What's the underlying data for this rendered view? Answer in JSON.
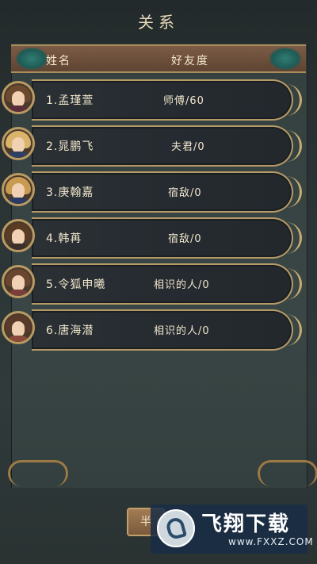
{
  "screen": {
    "title": "关系"
  },
  "table": {
    "headers": {
      "name": "姓名",
      "affinity": "好友度"
    },
    "rows": [
      {
        "name": "1.孟瑾萱",
        "affinity": "师傅/60"
      },
      {
        "name": "2.晁鹏飞",
        "affinity": "夫君/0"
      },
      {
        "name": "3.庚翰嘉",
        "affinity": "宿敌/0"
      },
      {
        "name": "4.韩苒",
        "affinity": "宿敌/0"
      },
      {
        "name": "5.令狐申曦",
        "affinity": "相识的人/0"
      },
      {
        "name": "6.唐海潜",
        "affinity": "相识的人/0"
      }
    ]
  },
  "avatars": [
    {
      "icon": "female-portrait-icon",
      "hair": "#6b4a2e",
      "body": "#5a2d3a"
    },
    {
      "icon": "male-portrait-icon",
      "hair": "#d9b46a",
      "body": "#2f3f63"
    },
    {
      "icon": "male-portrait-icon",
      "hair": "#c99a52",
      "body": "#2b3b63"
    },
    {
      "icon": "female-portrait-icon",
      "hair": "#5a3b24",
      "body": "#3a2f2a"
    },
    {
      "icon": "male-portrait-icon",
      "hair": "#6a4630",
      "body": "#7a3f3a"
    },
    {
      "icon": "male-portrait-icon",
      "hair": "#5a3a28",
      "body": "#8a4a3a"
    }
  ],
  "bottom": {
    "button_label": "半"
  },
  "watermark": {
    "title": "飞翔下载",
    "url": "www.FXXZ.COM"
  },
  "colors": {
    "accent_gold": "#b49a66",
    "header_brown": "#6d4f3c"
  }
}
